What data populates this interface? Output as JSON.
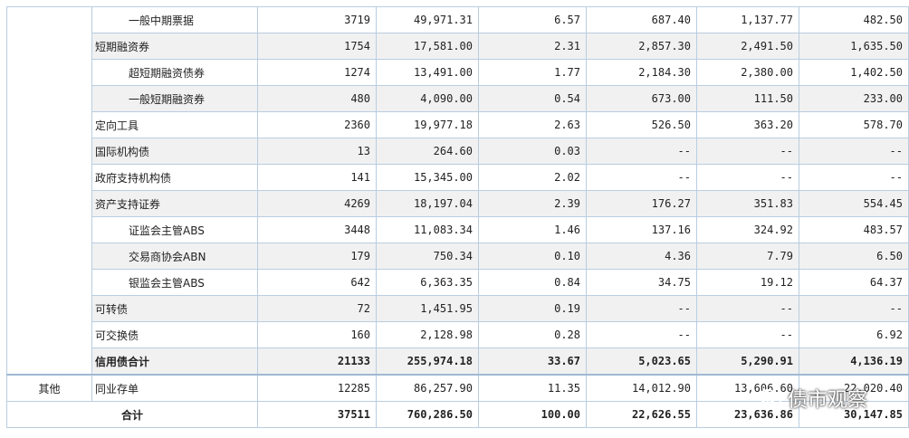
{
  "rows": [
    {
      "label": "一般中期票据",
      "count": "3719",
      "amount": "49,971.31",
      "pct": "6.57",
      "v1": "687.40",
      "v2": "1,137.77",
      "v3": "482.50"
    },
    {
      "label": "短期融资券",
      "count": "1754",
      "amount": "17,581.00",
      "pct": "2.31",
      "v1": "2,857.30",
      "v2": "2,491.50",
      "v3": "1,635.50"
    },
    {
      "label": "超短期融资债券",
      "count": "1274",
      "amount": "13,491.00",
      "pct": "1.77",
      "v1": "2,184.30",
      "v2": "2,380.00",
      "v3": "1,402.50"
    },
    {
      "label": "一般短期融资券",
      "count": "480",
      "amount": "4,090.00",
      "pct": "0.54",
      "v1": "673.00",
      "v2": "111.50",
      "v3": "233.00"
    },
    {
      "label": "定向工具",
      "count": "2360",
      "amount": "19,977.18",
      "pct": "2.63",
      "v1": "526.50",
      "v2": "363.20",
      "v3": "578.70"
    },
    {
      "label": "国际机构债",
      "count": "13",
      "amount": "264.60",
      "pct": "0.03",
      "v1": "--",
      "v2": "--",
      "v3": "--"
    },
    {
      "label": "政府支持机构债",
      "count": "141",
      "amount": "15,345.00",
      "pct": "2.02",
      "v1": "--",
      "v2": "--",
      "v3": "--"
    },
    {
      "label": "资产支持证券",
      "count": "4269",
      "amount": "18,197.04",
      "pct": "2.39",
      "v1": "176.27",
      "v2": "351.83",
      "v3": "554.45"
    },
    {
      "label": "证监会主管ABS",
      "count": "3448",
      "amount": "11,083.34",
      "pct": "1.46",
      "v1": "137.16",
      "v2": "324.92",
      "v3": "483.57"
    },
    {
      "label": "交易商协会ABN",
      "count": "179",
      "amount": "750.34",
      "pct": "0.10",
      "v1": "4.36",
      "v2": "7.79",
      "v3": "6.50"
    },
    {
      "label": "银监会主管ABS",
      "count": "642",
      "amount": "6,363.35",
      "pct": "0.84",
      "v1": "34.75",
      "v2": "19.12",
      "v3": "64.37"
    },
    {
      "label": "可转债",
      "count": "72",
      "amount": "1,451.95",
      "pct": "0.19",
      "v1": "--",
      "v2": "--",
      "v3": "--"
    },
    {
      "label": "可交换债",
      "count": "160",
      "amount": "2,128.98",
      "pct": "0.28",
      "v1": "--",
      "v2": "--",
      "v3": "6.92"
    },
    {
      "label": "信用债合计",
      "count": "21133",
      "amount": "255,974.18",
      "pct": "33.67",
      "v1": "5,023.65",
      "v2": "5,290.91",
      "v3": "4,136.19"
    }
  ],
  "other": {
    "category": "其他",
    "label": "同业存单",
    "count": "12285",
    "amount": "86,257.90",
    "pct": "11.35",
    "v1": "14,012.90",
    "v2": "13,606.60",
    "v3": "22,020.40"
  },
  "total": {
    "label": "合计",
    "count": "37511",
    "amount": "760,286.50",
    "pct": "100.00",
    "v1": "22,626.55",
    "v2": "23,636.86",
    "v3": "30,147.85"
  },
  "watermark": {
    "text": "债市观察",
    "icon": "wechat-icon"
  }
}
